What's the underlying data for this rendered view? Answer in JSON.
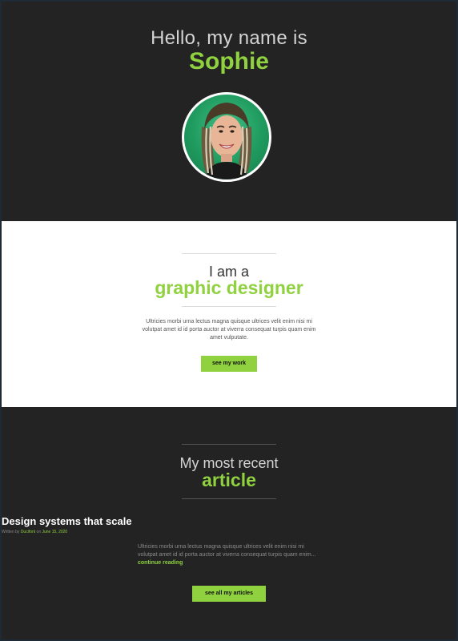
{
  "hero": {
    "greeting": "Hello, my name is",
    "name": "Sophie"
  },
  "about": {
    "intro": "I am a",
    "role": "graphic designer",
    "description": "Ultricies morbi urna lectus magna quisque ultrices velit enim nisi mi volutpat amet id id porta auctor at viverra consequat turpis quam enim amet vulputate.",
    "button_label": "see my work"
  },
  "articles": {
    "intro": "My most recent",
    "heading": "article",
    "article_title": "Design systems that scale",
    "byline_prefix": "Written by",
    "byline_author": "Ducifont",
    "byline_on": "on",
    "byline_date": "June 15, 2020",
    "excerpt": "Ultricies morbi urna lectus magna quisque ultrices velit enim nisi mi volutpat amet id id porta auctor at viverra consequat turpis quam enim...",
    "read_more": "continue reading",
    "button_label": "see all my articles"
  },
  "colors": {
    "accent": "#8fd13f",
    "dark_bg": "#232323",
    "light_bg": "#ffffff"
  }
}
